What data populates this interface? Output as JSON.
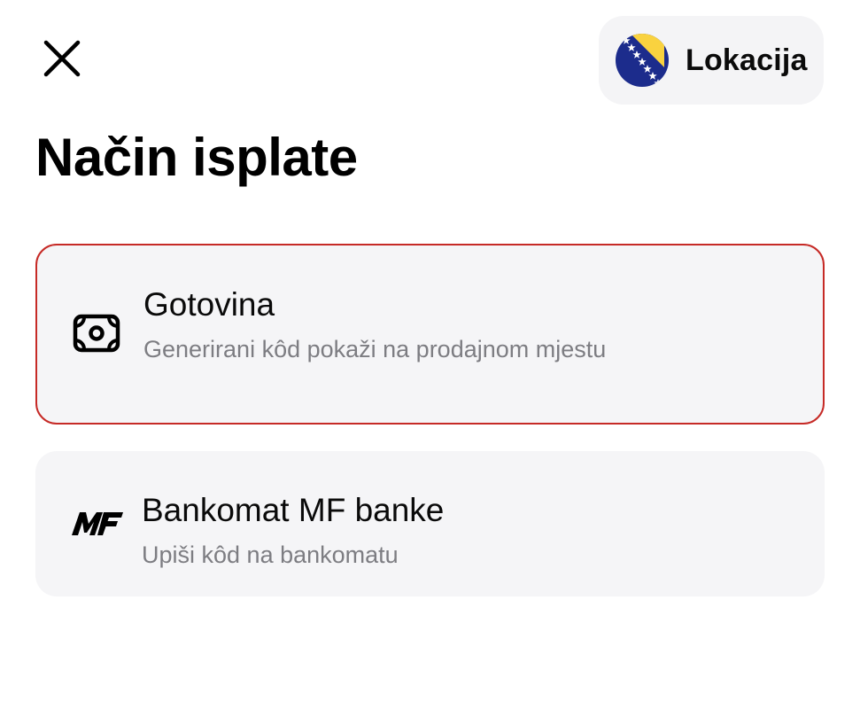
{
  "header": {
    "close_icon": "close-icon",
    "location": {
      "label": "Lokacija",
      "flag_icon": "bosnia-herzegovina-flag-icon"
    }
  },
  "title": "Način isplate",
  "options": [
    {
      "title": "Gotovina",
      "subtitle": "Generirani kôd pokaži na prodajnom mjestu",
      "icon": "cash-icon",
      "selected": true
    },
    {
      "title": "Bankomat MF banke",
      "subtitle": "Upiši kôd na bankomatu",
      "icon": "mf-bank-logo-icon",
      "logo_text": "MF",
      "selected": false
    }
  ],
  "colors": {
    "selected_border": "#c62a26",
    "card_background": "#f5f5f7",
    "subtitle_text": "#7d7d82",
    "flag_blue": "#1c2c8c",
    "flag_yellow": "#f9d23f"
  }
}
